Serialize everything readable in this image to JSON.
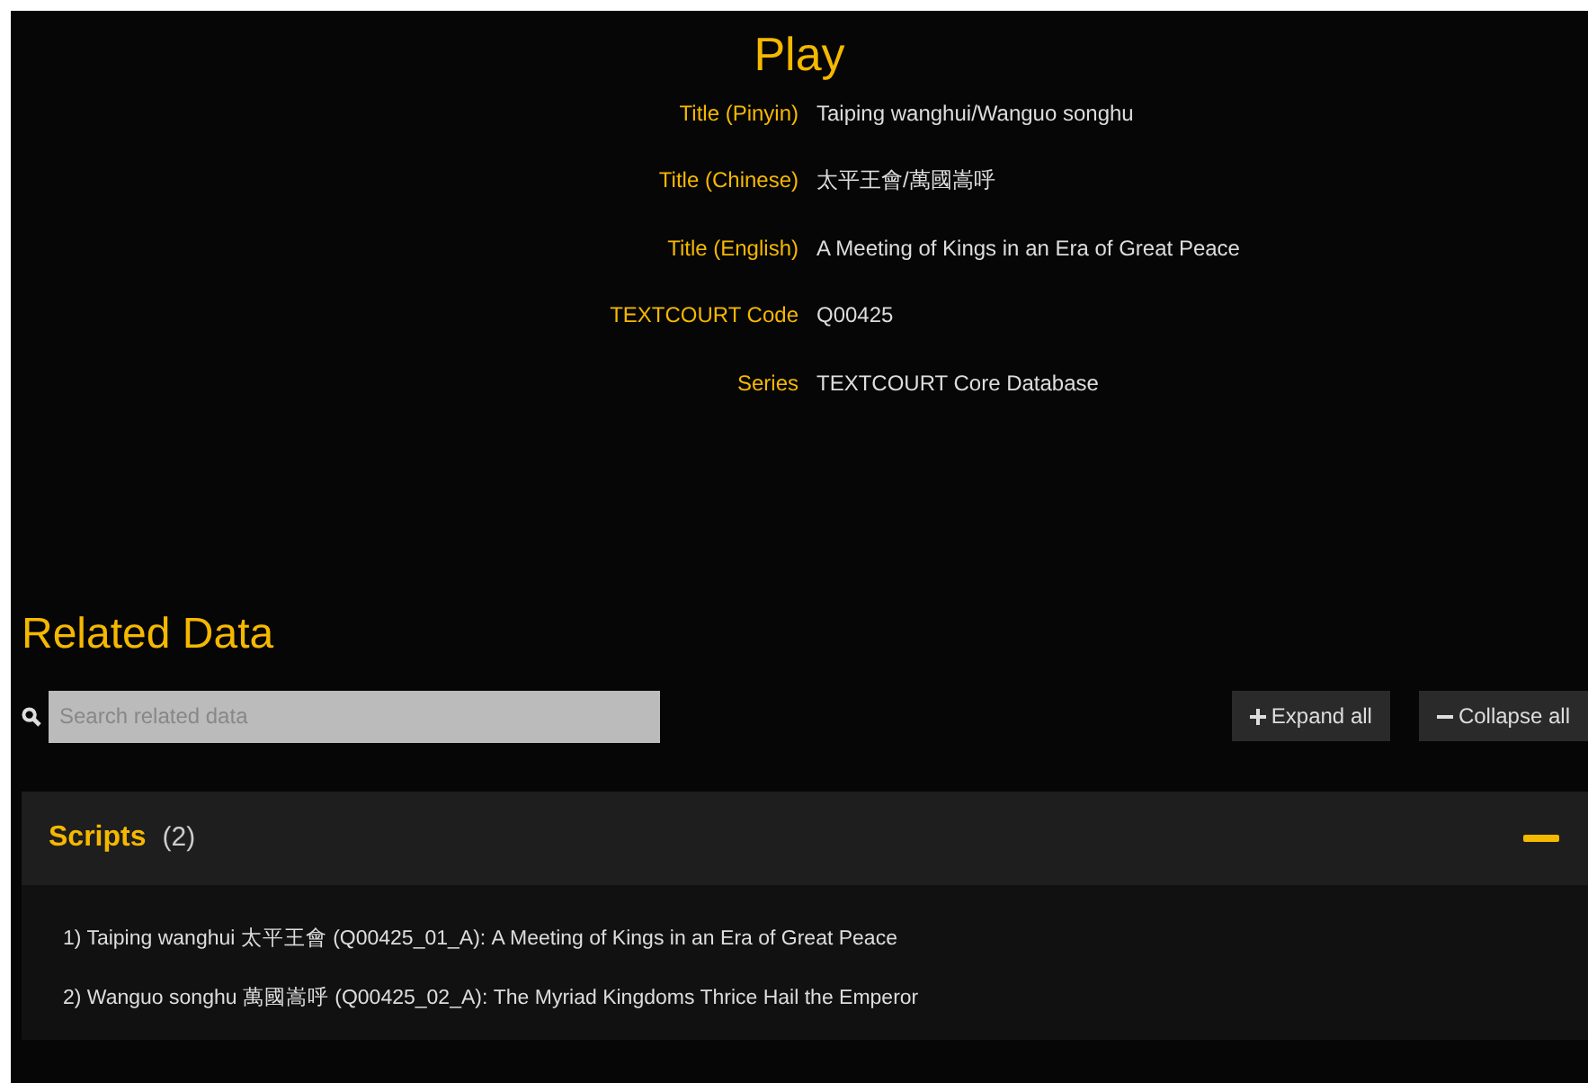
{
  "heading": "Play",
  "fields": [
    {
      "label": "Title (Pinyin)",
      "value": "Taiping wanghui/Wanguo songhu"
    },
    {
      "label": "Title (Chinese)",
      "value": "太平王會/萬國嵩呼"
    },
    {
      "label": "Title (English)",
      "value": "A Meeting of Kings in an Era of Great Peace"
    },
    {
      "label": "TEXTCOURT Code",
      "value": "Q00425"
    },
    {
      "label": "Series",
      "value": "TEXTCOURT Core Database"
    }
  ],
  "related": {
    "heading": "Related Data",
    "search": {
      "placeholder": "Search related data"
    },
    "buttons": [
      {
        "kind": "expand",
        "label": "Expand all"
      },
      {
        "kind": "collapse",
        "label": "Collapse all"
      }
    ],
    "sections": [
      {
        "title": "Scripts",
        "count": "(2)",
        "expanded": true,
        "items": [
          "1) Taiping wanghui 太平王會 (Q00425_01_A): A Meeting of Kings in an Era of Great Peace",
          "2) Wanguo songhu 萬國嵩呼 (Q00425_02_A): The Myriad Kingdoms Thrice Hail the Emperor"
        ]
      }
    ]
  }
}
